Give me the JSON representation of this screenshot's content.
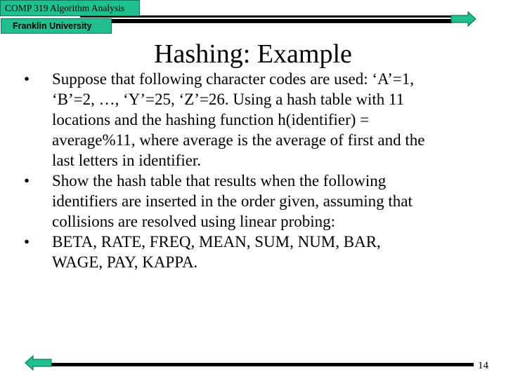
{
  "header": {
    "course_label": "COMP 319 Algorithm Analysis",
    "school_label": "Franklin University"
  },
  "colors": {
    "accent": "#1fc08f",
    "accent_border": "#0e7a58",
    "rule": "#000000"
  },
  "navigation": {
    "next_icon": "right-arrow-icon",
    "prev_icon": "left-arrow-icon"
  },
  "slide": {
    "title": "Hashing: Example",
    "bullets": [
      {
        "marker": "•",
        "text": "Suppose that following character codes are used: ‘A’=1,\n‘B’=2, …, ‘Y’=25, ‘Z’=26. Using a hash table with 11\nlocations and the hashing function h(identifier) =\naverage%11, where average is  the average of  first and the\nlast letters in identifier."
      },
      {
        "marker": "•",
        "text": " Show the hash table that results when the following\nidentifiers are inserted in the order given, assuming that\ncollisions are resolved using linear probing:"
      },
      {
        "marker": "•",
        "text": " BETA, RATE, FREQ, MEAN, SUM, NUM, BAR,\nWAGE, PAY, KAPPA."
      }
    ],
    "identifiers": [
      "BETA",
      "RATE",
      "FREQ",
      "MEAN",
      "SUM",
      "NUM",
      "BAR",
      "WAGE",
      "PAY",
      "KAPPA"
    ]
  },
  "footer": {
    "page_number": "14"
  }
}
